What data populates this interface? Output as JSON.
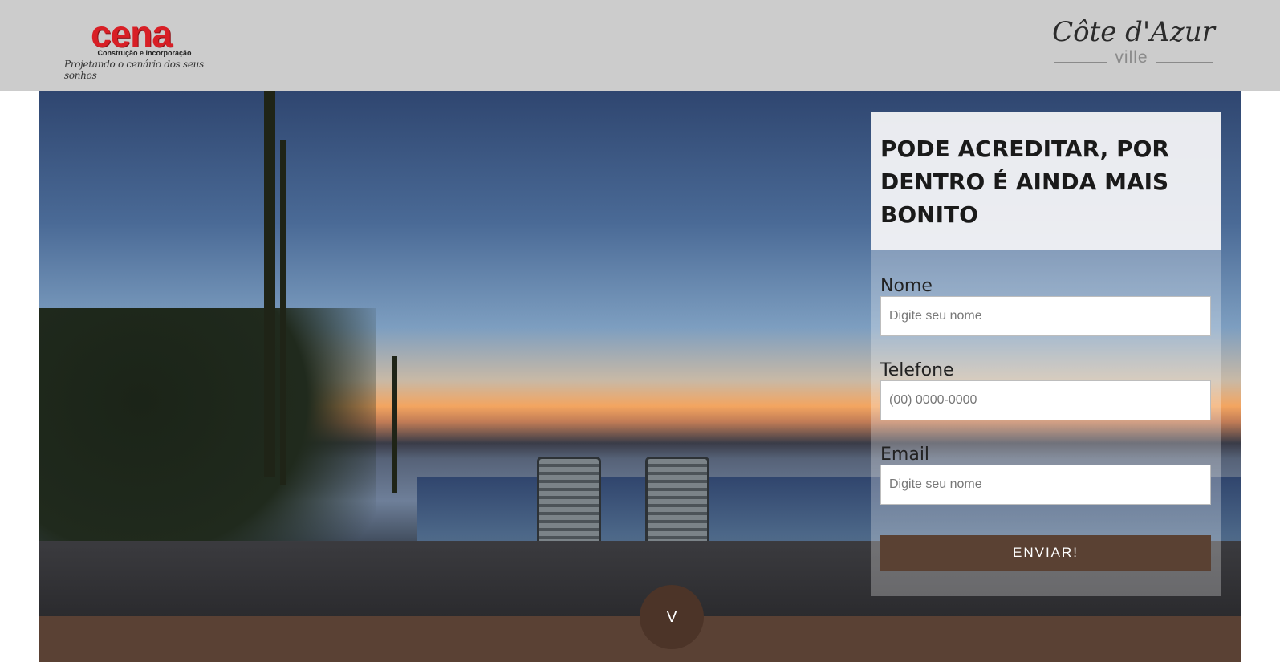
{
  "header": {
    "brand_left": {
      "name": "cena",
      "subtitle": "Construção e Incorporação",
      "tagline": "Projetando o cenário dos seus sonhos"
    },
    "brand_right": {
      "name": "Côte d'Azur",
      "subname": "ville"
    },
    "background_color": "#cccccc"
  },
  "hero": {
    "image_description_icon": "sunset-pool-photo"
  },
  "form": {
    "title": "PODE ACREDITAR, POR DENTRO É AINDA MAIS BONITO",
    "fields": [
      {
        "label": "Nome",
        "placeholder": "Digite seu nome",
        "value": ""
      },
      {
        "label": "Telefone",
        "placeholder": "(00) 0000-0000",
        "value": ""
      },
      {
        "label": "Email",
        "placeholder": "Digite seu nome",
        "value": ""
      }
    ],
    "submit_label": "ENVIAR!",
    "button_color": "#5a4133"
  },
  "scroll_button": {
    "label": "V"
  },
  "colors": {
    "brand_red": "#d81f26",
    "band_brown": "#5a4134"
  }
}
